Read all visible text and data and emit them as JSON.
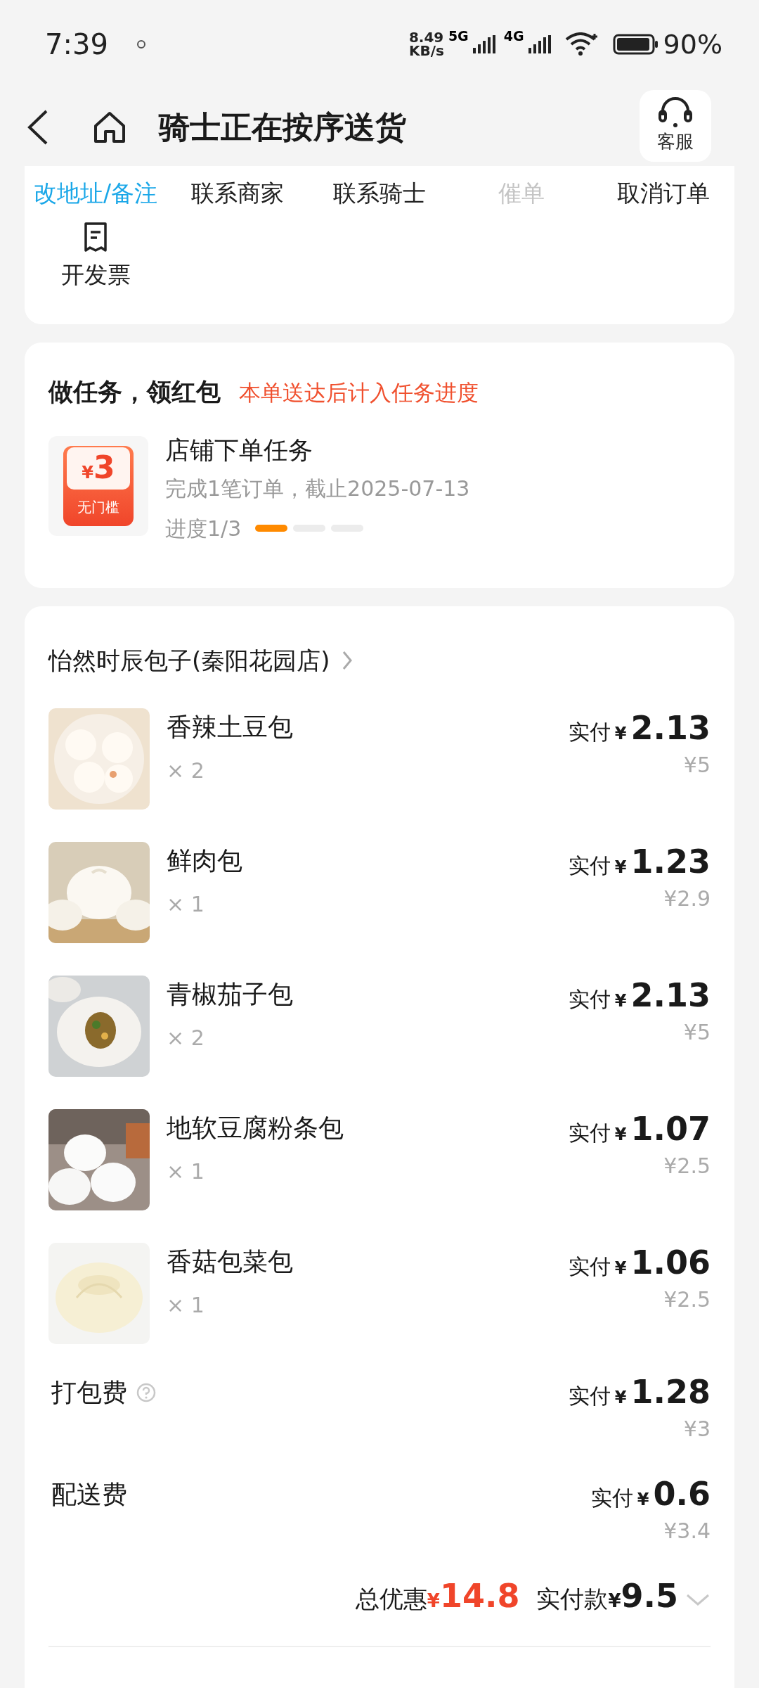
{
  "status_bar": {
    "time": "7:39",
    "speed_value": "8.49",
    "speed_unit": "KB/s",
    "network_1": "5G",
    "network_2": "4G",
    "battery": "90%"
  },
  "header": {
    "title": "骑士正在按序送货",
    "service_label": "客服"
  },
  "actions": [
    {
      "label": "改地址/备注",
      "highlighted": true,
      "disabled": false
    },
    {
      "label": "联系商家",
      "highlighted": false,
      "disabled": false
    },
    {
      "label": "联系骑士",
      "highlighted": false,
      "disabled": false
    },
    {
      "label": "催单",
      "highlighted": false,
      "disabled": true
    },
    {
      "label": "取消订单",
      "highlighted": false,
      "disabled": false
    }
  ],
  "invoice": {
    "label": "开发票"
  },
  "task_card": {
    "title": "做任务，领红包",
    "subtitle": "本单送达后计入任务进度",
    "coupon_currency": "¥",
    "coupon_amount": "3",
    "coupon_label": "无门槛",
    "task_title": "店铺下单任务",
    "task_desc": "完成1笔订单，截止2025-07-13",
    "progress_text": "进度1/3",
    "progress_steps": [
      {
        "done": true
      },
      {
        "done": false
      },
      {
        "done": false
      }
    ]
  },
  "store": {
    "name": "怡然时辰包子(秦阳花园店)",
    "items": [
      {
        "name": "香辣土豆包",
        "quantity": "× 2",
        "paid_label": "实付",
        "currency": "¥",
        "paid": "2.13",
        "original": "¥5"
      },
      {
        "name": "鲜肉包",
        "quantity": "× 1",
        "paid_label": "实付",
        "currency": "¥",
        "paid": "1.23",
        "original": "¥2.9"
      },
      {
        "name": "青椒茄子包",
        "quantity": "× 2",
        "paid_label": "实付",
        "currency": "¥",
        "paid": "2.13",
        "original": "¥5"
      },
      {
        "name": "地软豆腐粉条包",
        "quantity": "× 1",
        "paid_label": "实付",
        "currency": "¥",
        "paid": "1.07",
        "original": "¥2.5"
      },
      {
        "name": "香菇包菜包",
        "quantity": "× 1",
        "paid_label": "实付",
        "currency": "¥",
        "paid": "1.06",
        "original": "¥2.5"
      }
    ],
    "fees": [
      {
        "name": "打包费",
        "kind": "help",
        "paid_label": "实付",
        "currency": "¥",
        "paid": "1.28",
        "original": "¥3"
      },
      {
        "name": "配送费",
        "kind": "plain",
        "paid_label": "实付",
        "currency": "¥",
        "paid": "0.6",
        "original": "¥3.4"
      }
    ],
    "totals": {
      "discount_label": "总优惠",
      "discount_currency": "¥",
      "discount": "14.8",
      "paid_label": "实付款",
      "paid_currency": "¥",
      "paid": "9.5"
    }
  }
}
